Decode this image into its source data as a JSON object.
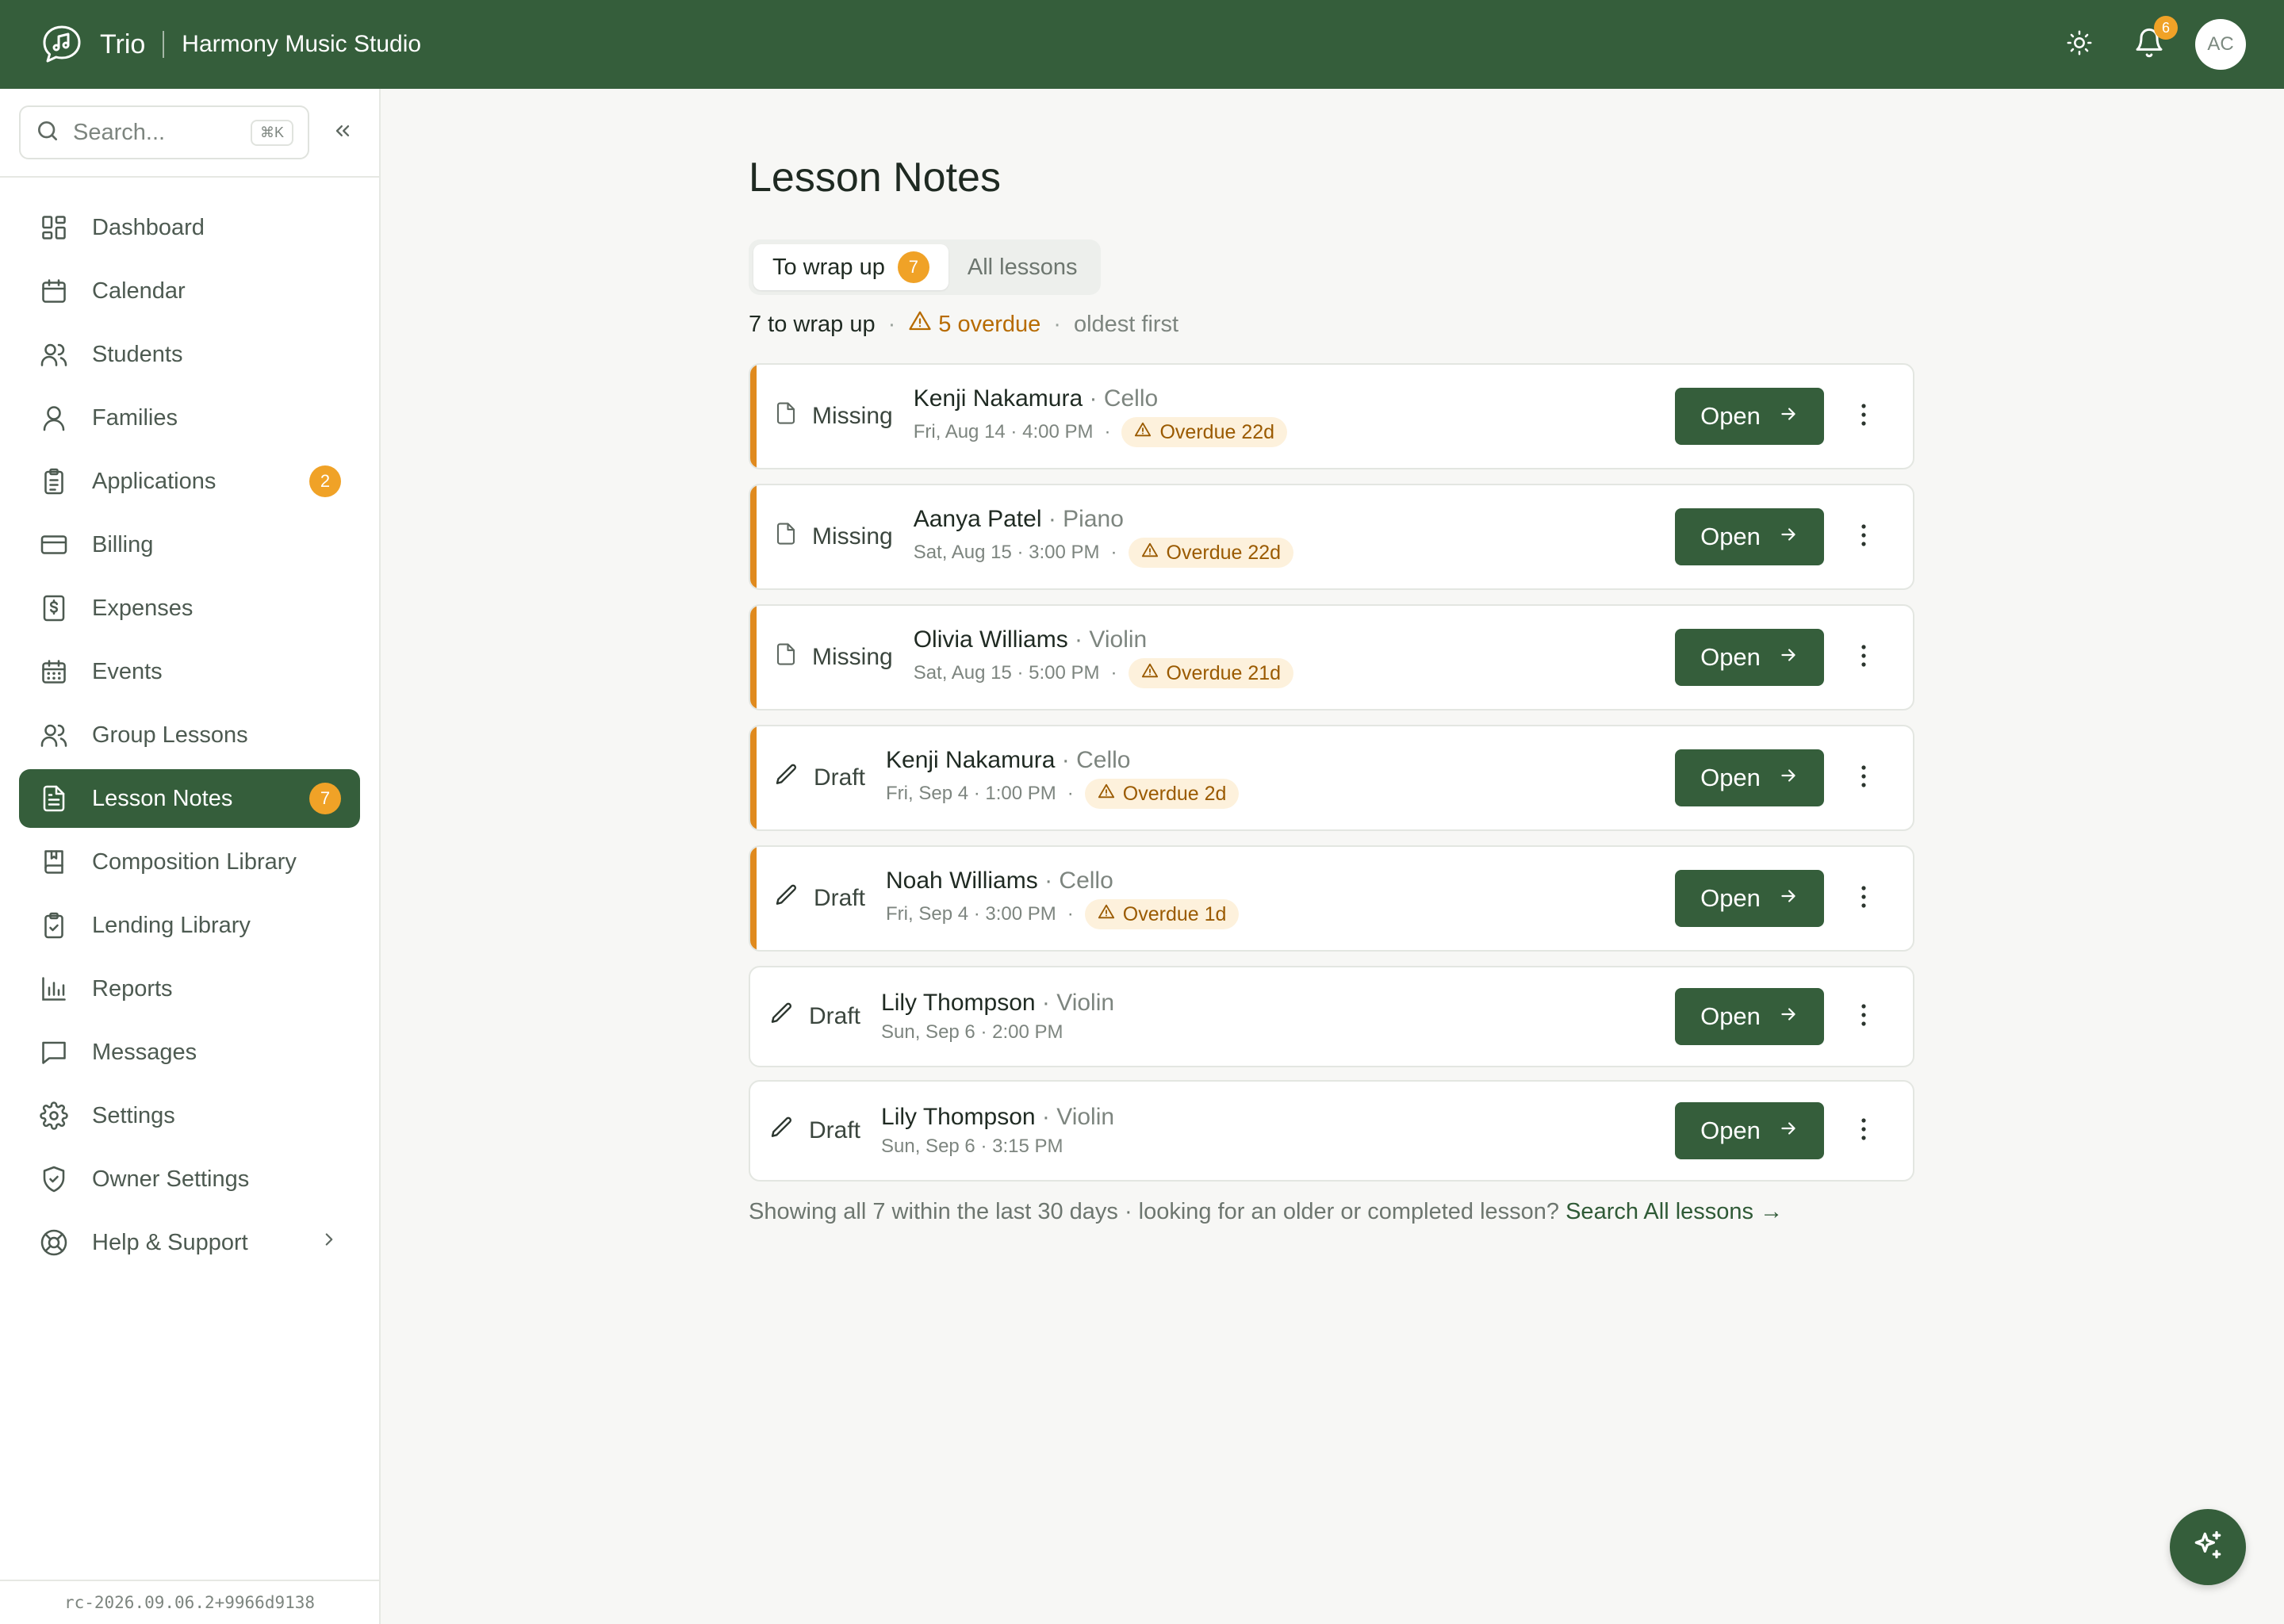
{
  "header": {
    "app_name": "Trio",
    "studio_name": "Harmony Music Studio",
    "notification_count": "6",
    "avatar_initials": "AC"
  },
  "sidebar": {
    "search_placeholder": "Search...",
    "search_shortcut": "⌘K",
    "items": [
      {
        "label": "Dashboard",
        "icon": "dashboard-icon"
      },
      {
        "label": "Calendar",
        "icon": "calendar-icon"
      },
      {
        "label": "Students",
        "icon": "students-icon"
      },
      {
        "label": "Families",
        "icon": "person-icon"
      },
      {
        "label": "Applications",
        "icon": "clipboard-icon",
        "count": "2"
      },
      {
        "label": "Billing",
        "icon": "credit-card-icon"
      },
      {
        "label": "Expenses",
        "icon": "receipt-icon"
      },
      {
        "label": "Events",
        "icon": "calendar-grid-icon"
      },
      {
        "label": "Group Lessons",
        "icon": "group-icon"
      },
      {
        "label": "Lesson Notes",
        "icon": "document-icon",
        "count": "7",
        "active": true
      },
      {
        "label": "Composition Library",
        "icon": "book-icon"
      },
      {
        "label": "Lending Library",
        "icon": "clipboard-check-icon"
      },
      {
        "label": "Reports",
        "icon": "bar-chart-icon"
      },
      {
        "label": "Messages",
        "icon": "message-icon"
      },
      {
        "label": "Settings",
        "icon": "gear-icon"
      },
      {
        "label": "Owner Settings",
        "icon": "shield-check-icon"
      },
      {
        "label": "Help & Support",
        "icon": "lifebuoy-icon"
      }
    ],
    "version": "rc-2026.09.06.2+9966d9138"
  },
  "main": {
    "title": "Lesson Notes",
    "tabs": [
      {
        "label": "To wrap up",
        "count": "7",
        "active": true
      },
      {
        "label": "All lessons"
      }
    ],
    "summary": {
      "to_wrap_up": "7 to wrap up",
      "overdue": "5 overdue",
      "sort": "oldest first",
      "separator": "·"
    },
    "open_label": "Open",
    "rows": [
      {
        "status": "Missing",
        "name": "Kenji Nakamura",
        "instrument": "Cello",
        "when": "Fri, Aug 14 · 4:00 PM",
        "overdue": "Overdue 22d"
      },
      {
        "status": "Missing",
        "name": "Aanya Patel",
        "instrument": "Piano",
        "when": "Sat, Aug 15 · 3:00 PM",
        "overdue": "Overdue 22d"
      },
      {
        "status": "Missing",
        "name": "Olivia Williams",
        "instrument": "Violin",
        "when": "Sat, Aug 15 · 5:00 PM",
        "overdue": "Overdue 21d"
      },
      {
        "status": "Draft",
        "name": "Kenji Nakamura",
        "instrument": "Cello",
        "when": "Fri, Sep 4 · 1:00 PM",
        "overdue": "Overdue 2d"
      },
      {
        "status": "Draft",
        "name": "Noah Williams",
        "instrument": "Cello",
        "when": "Fri, Sep 4 · 3:00 PM",
        "overdue": "Overdue 1d"
      },
      {
        "status": "Draft",
        "name": "Lily Thompson",
        "instrument": "Violin",
        "when": "Sun, Sep 6 · 2:00 PM"
      },
      {
        "status": "Draft",
        "name": "Lily Thompson",
        "instrument": "Violin",
        "when": "Sun, Sep 6 · 3:15 PM"
      }
    ],
    "footer": {
      "text": "Showing all 7 within the last 30 days · looking for an older or completed lesson?",
      "link": "Search All lessons →"
    }
  },
  "colors": {
    "brand": "#355e3b",
    "accent_badge": "#f0a227",
    "overdue_text": "#9a5a00",
    "overdue_bg": "#fdf1dc",
    "row_flag": "#e08a1e"
  }
}
